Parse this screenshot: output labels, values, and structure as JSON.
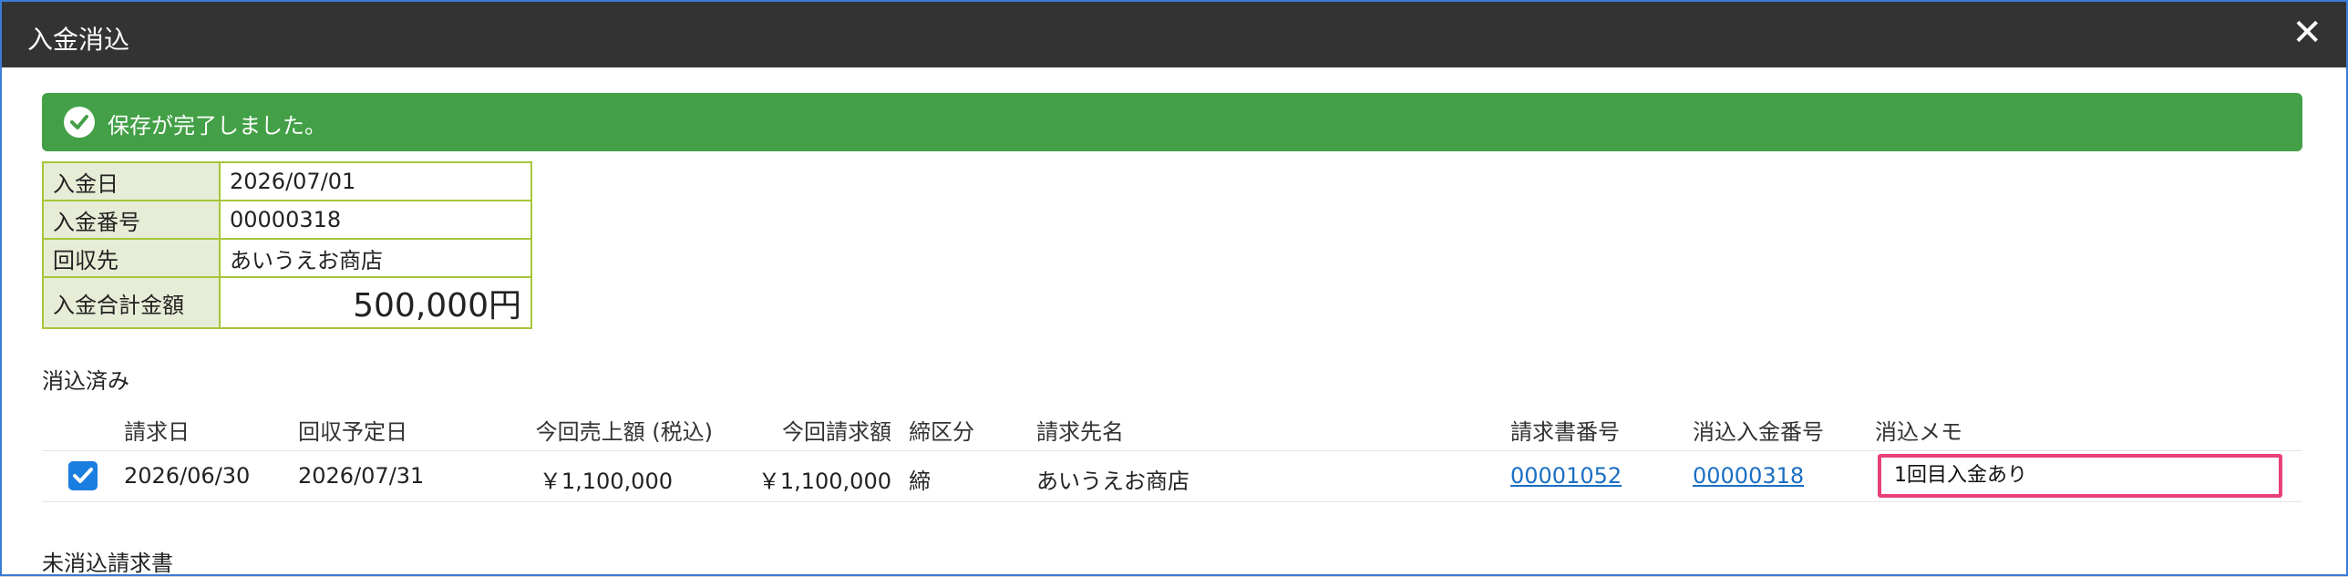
{
  "dialog": {
    "title": "入金消込",
    "close_label": "✕"
  },
  "alert": {
    "message": "保存が完了しました。"
  },
  "payment_info": [
    {
      "label": "入金日",
      "value": "2026/07/01"
    },
    {
      "label": "入金番号",
      "value": "00000318"
    },
    {
      "label": "回収先",
      "value": "あいうえお商店"
    },
    {
      "label": "入金合計金額",
      "value": "500,000円"
    }
  ],
  "reconciled": {
    "section_label": "消込済み",
    "headers": {
      "billing_date": "請求日",
      "due_date": "回収予定日",
      "sales_amount": "今回売上額 (税込)",
      "invoice_amount": "今回請求額",
      "closing": "締区分",
      "billing_to": "請求先名",
      "invoice_no": "請求書番号",
      "payment_no": "消込入金番号",
      "memo": "消込メモ"
    },
    "rows": [
      {
        "checked": true,
        "billing_date": "2026/06/30",
        "due_date": "2026/07/31",
        "sales_amount": "￥1,100,000",
        "invoice_amount": "￥1,100,000",
        "closing": "締",
        "billing_to": "あいうえお商店",
        "invoice_no": "00001052",
        "payment_no": "00000318",
        "memo": "1回目入金あり"
      }
    ]
  },
  "unreconciled": {
    "section_label": "未消込請求書"
  },
  "colors": {
    "titlebar": "#333333",
    "alert": "#43a047",
    "table_border": "#a6c639",
    "link": "#1a6fc4",
    "memo_highlight": "#e8407a",
    "checkbox": "#1a7ee0"
  }
}
